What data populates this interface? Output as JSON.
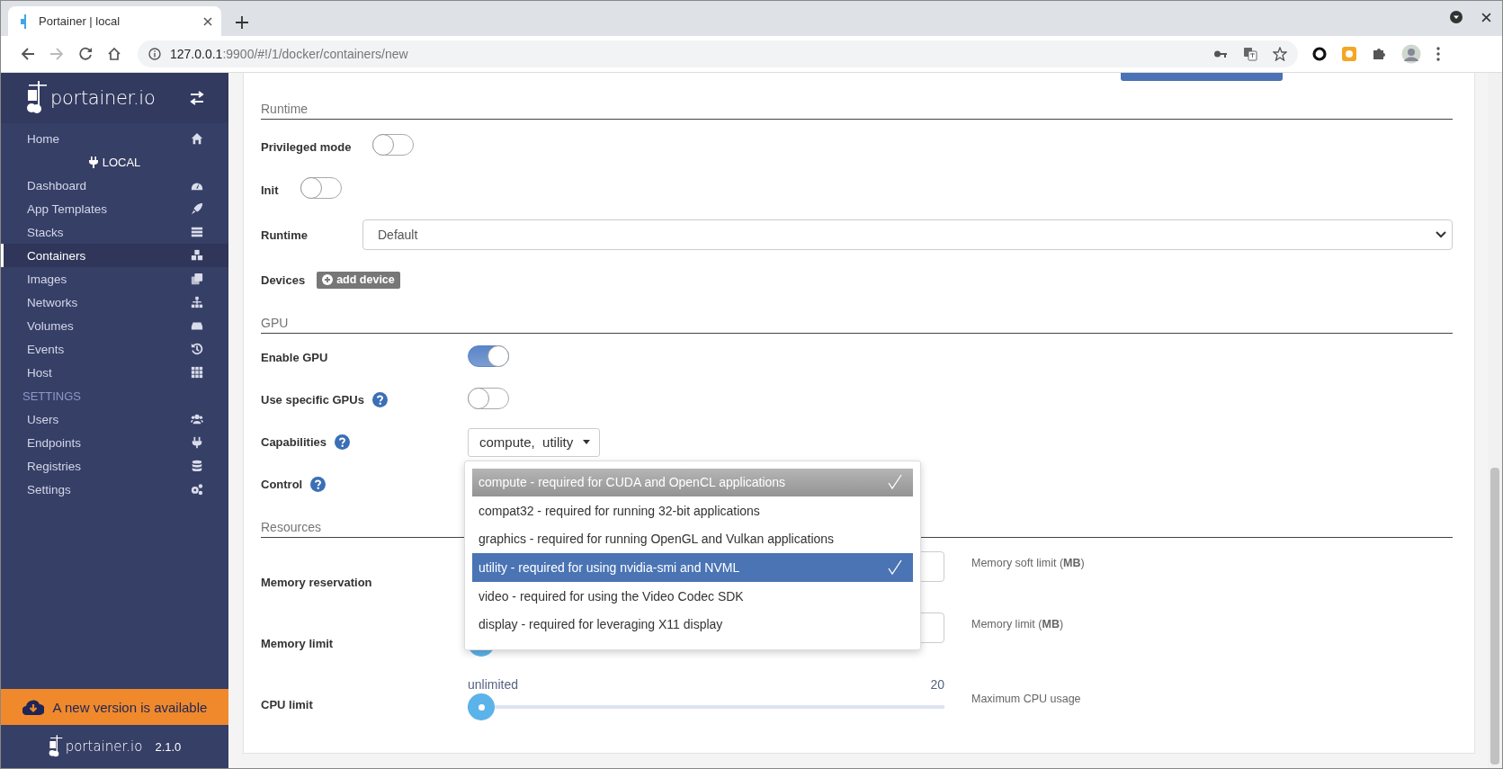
{
  "browser": {
    "tab": {
      "title": "Portainer | local"
    },
    "address": {
      "host": "127.0.0.1",
      "rest": ":9900/#!/1/docker/containers/new"
    }
  },
  "sidebar": {
    "brand": "portainer.io",
    "entries": [
      {
        "kind": "item",
        "label": "Home",
        "selected": false
      },
      {
        "kind": "endpoint",
        "label": "LOCAL"
      },
      {
        "kind": "item",
        "label": "Dashboard",
        "selected": false
      },
      {
        "kind": "item",
        "label": "App Templates",
        "selected": false
      },
      {
        "kind": "item",
        "label": "Stacks",
        "selected": false
      },
      {
        "kind": "item",
        "label": "Containers",
        "selected": true
      },
      {
        "kind": "item",
        "label": "Images",
        "selected": false
      },
      {
        "kind": "item",
        "label": "Networks",
        "selected": false
      },
      {
        "kind": "item",
        "label": "Volumes",
        "selected": false
      },
      {
        "kind": "item",
        "label": "Events",
        "selected": false
      },
      {
        "kind": "item",
        "label": "Host",
        "selected": false
      },
      {
        "kind": "heading",
        "label": "SETTINGS"
      },
      {
        "kind": "item",
        "label": "Users",
        "selected": false
      },
      {
        "kind": "item",
        "label": "Endpoints",
        "selected": false
      },
      {
        "kind": "item",
        "label": "Registries",
        "selected": false
      },
      {
        "kind": "item",
        "label": "Settings",
        "selected": false
      }
    ],
    "update_banner": "A new version is available",
    "footer": {
      "brand": "portainer.io",
      "version": "2.1.0"
    }
  },
  "main": {
    "sections": [
      {
        "title": "Runtime",
        "rows": [
          {
            "kind": "toggle",
            "label": "Privileged mode",
            "on": false
          },
          {
            "kind": "toggle",
            "label": "Init",
            "on": false
          },
          {
            "kind": "select",
            "label": "Runtime",
            "value": "Default"
          },
          {
            "kind": "button",
            "label": "Devices",
            "button": "add device"
          }
        ]
      },
      {
        "title": "GPU",
        "rows": [
          {
            "kind": "toggle",
            "label": "Enable GPU",
            "on": true
          },
          {
            "kind": "toggle",
            "label": "Use specific GPUs",
            "help": true,
            "on": false
          },
          {
            "kind": "multiselect",
            "label": "Capabilities",
            "help": true,
            "value": "compute,  utility",
            "options": [
              {
                "label": "compute - required for CUDA and OpenCL applications",
                "checked": true,
                "highlighted": true
              },
              {
                "label": "compat32 - required for running 32-bit applications",
                "checked": false,
                "highlighted": false
              },
              {
                "label": "graphics - required for running OpenGL and Vulkan applications",
                "checked": false,
                "highlighted": false
              },
              {
                "label": "utility - required for using nvidia-smi and NVML",
                "checked": true,
                "highlighted": false
              },
              {
                "label": "video - required for using the Video Codec SDK",
                "checked": false,
                "highlighted": false
              },
              {
                "label": "display - required for leveraging X11 display",
                "checked": false,
                "highlighted": false
              }
            ]
          },
          {
            "kind": "label",
            "label": "Control",
            "help": true
          }
        ]
      },
      {
        "title": "Resources",
        "rows": [
          {
            "kind": "memory",
            "label": "Memory reservation",
            "hint": "Memory soft limit (**MB**)"
          },
          {
            "kind": "memory",
            "label": "Memory limit",
            "hint": "Memory limit (**MB**)",
            "level": 0
          },
          {
            "kind": "slider",
            "label": "CPU limit",
            "min_label": "unlimited",
            "max_label": "20",
            "level": 0,
            "hint": "Maximum CPU usage"
          }
        ]
      }
    ]
  }
}
